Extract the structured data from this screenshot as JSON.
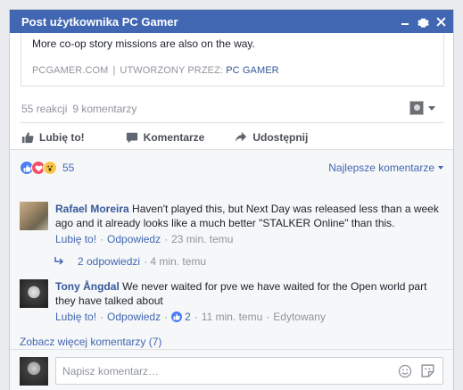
{
  "window": {
    "title": "Post użytkownika PC Gamer"
  },
  "post": {
    "body_text": "More co-op story missions are also on the way.",
    "source": "PCGAMER.COM",
    "created_by_label": "UTWORZONY PRZEZ:",
    "created_by_page": "PC GAMER"
  },
  "stats": {
    "reactions": "55 reakcji",
    "comments": "9 komentarzy"
  },
  "actions": {
    "like": "Lubię to!",
    "comment": "Komentarze",
    "share": "Udostępnij"
  },
  "reactions_bar": {
    "count": "55",
    "sort_label": "Najlepsze komentarze"
  },
  "comments": [
    {
      "author": "Rafael Moreira",
      "text": "Haven't played this, but Next Day was released less than a week ago and it already looks like a much better \"STALKER Online\" than this.",
      "like": "Lubię to!",
      "reply": "Odpowiedz",
      "time": "23 min. temu"
    },
    {
      "author": "Tony Ångdal",
      "text": "We never waited for pve we have waited for the Open world part they have talked about",
      "like": "Lubię to!",
      "reply": "Odpowiedz",
      "likes": "2",
      "time": "11 min. temu",
      "edited": "Edytowany"
    }
  ],
  "replies": {
    "label": "2 odpowiedzi",
    "time": "4 min. temu"
  },
  "more_comments": "Zobacz więcej komentarzy (7)",
  "composer": {
    "placeholder": "Napisz komentarz…"
  },
  "colors": {
    "brand": "#4267b2",
    "link": "#365899",
    "muted": "#90949c"
  }
}
